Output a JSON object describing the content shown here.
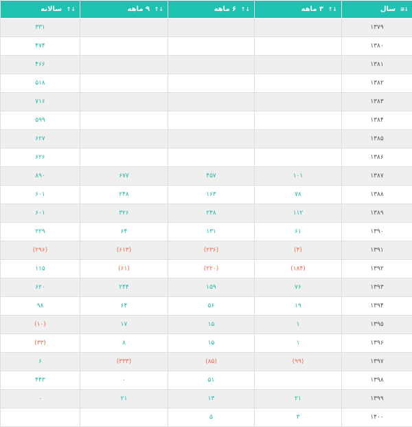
{
  "colors": {
    "header_bg": "#1fc1b1",
    "positive": "#1fb9aa",
    "negative": "#f06a4e",
    "year_text": "#555555",
    "stripe": "#efefef"
  },
  "headers": [
    {
      "key": "year",
      "label": "سال",
      "sort_icon": "sort-asc-icon",
      "sort_glyph": "↓≡"
    },
    {
      "key": "m3",
      "label": "۳ ماهه",
      "sort_icon": "sort-icon",
      "sort_glyph": "↓↑"
    },
    {
      "key": "m6",
      "label": "۶ ماهه",
      "sort_icon": "sort-icon",
      "sort_glyph": "↓↑"
    },
    {
      "key": "m9",
      "label": "۹ ماهه",
      "sort_icon": "sort-icon",
      "sort_glyph": "↓↑"
    },
    {
      "key": "yr",
      "label": "سالانه",
      "sort_icon": "sort-icon",
      "sort_glyph": "↓↑"
    }
  ],
  "rows": [
    {
      "year": "۱۳۷۹",
      "m3": "",
      "m6": "",
      "m9": "",
      "yr": "۳۳۱"
    },
    {
      "year": "۱۳۸۰",
      "m3": "",
      "m6": "",
      "m9": "",
      "yr": "۴۷۴"
    },
    {
      "year": "۱۳۸۱",
      "m3": "",
      "m6": "",
      "m9": "",
      "yr": "۴۶۶"
    },
    {
      "year": "۱۳۸۲",
      "m3": "",
      "m6": "",
      "m9": "",
      "yr": "۵۱۸"
    },
    {
      "year": "۱۳۸۳",
      "m3": "",
      "m6": "",
      "m9": "",
      "yr": "۷۱۶"
    },
    {
      "year": "۱۳۸۴",
      "m3": "",
      "m6": "",
      "m9": "",
      "yr": "۵۹۹"
    },
    {
      "year": "۱۳۸۵",
      "m3": "",
      "m6": "",
      "m9": "",
      "yr": "۶۲۷"
    },
    {
      "year": "۱۳۸۶",
      "m3": "",
      "m6": "",
      "m9": "",
      "yr": "۶۲۶"
    },
    {
      "year": "۱۳۸۷",
      "m3": "۱۰۱",
      "m6": "۴۵۷",
      "m9": "۶۷۷",
      "yr": "۸۹۰"
    },
    {
      "year": "۱۳۸۸",
      "m3": "۷۸",
      "m6": "۱۶۳",
      "m9": "۲۴۸",
      "yr": "۶۰۱"
    },
    {
      "year": "۱۳۸۹",
      "m3": "۱۱۲",
      "m6": "۲۴۸",
      "m9": "۳۲۶",
      "yr": "۶۰۱"
    },
    {
      "year": "۱۳۹۰",
      "m3": "۶۱",
      "m6": "۱۳۱",
      "m9": "۶۴",
      "yr": "۲۲۹"
    },
    {
      "year": "۱۳۹۱",
      "m3": "(۴)",
      "m6": "(۲۳۶)",
      "m9": "(۶۱۳)",
      "yr": "(۲۹۶)"
    },
    {
      "year": "۱۳۹۲",
      "m3": "(۱۸۴)",
      "m6": "(۲۲۰)",
      "m9": "(۶۱)",
      "yr": "۱۱۵"
    },
    {
      "year": "۱۳۹۳",
      "m3": "۷۶",
      "m6": "۱۵۹",
      "m9": "۲۴۴",
      "yr": "۶۲۰"
    },
    {
      "year": "۱۳۹۴",
      "m3": "۱۹",
      "m6": "۵۶",
      "m9": "۶۴",
      "yr": "۹۸"
    },
    {
      "year": "۱۳۹۵",
      "m3": "۱",
      "m6": "۱۵",
      "m9": "۱۷",
      "yr": "(۱۰)"
    },
    {
      "year": "۱۳۹۶",
      "m3": "۱",
      "m6": "۱۵",
      "m9": "۸",
      "yr": "(۳۳)"
    },
    {
      "year": "۱۳۹۷",
      "m3": "(۹۹)",
      "m6": "(۸۵)",
      "m9": "(۳۳۳)",
      "yr": "۶"
    },
    {
      "year": "۱۳۹۸",
      "m3": "",
      "m6": "۵۱",
      "m9": "۰",
      "yr": "۴۴۳"
    },
    {
      "year": "۱۳۹۹",
      "m3": "۲۱",
      "m6": "۱۳",
      "m9": "۲۱",
      "yr": "۰"
    },
    {
      "year": "۱۴۰۰",
      "m3": "۳",
      "m6": "۵",
      "m9": "",
      "yr": ""
    }
  ]
}
